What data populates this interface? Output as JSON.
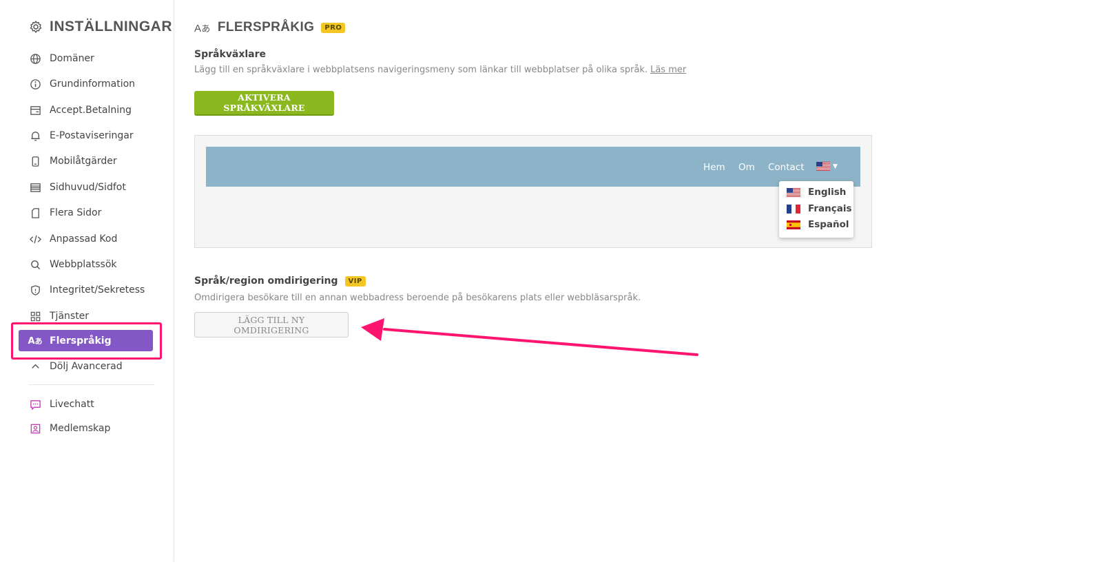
{
  "sidebar": {
    "title": "INSTÄLLNINGAR",
    "items": [
      {
        "label": "Domäner",
        "icon": "globe-icon"
      },
      {
        "label": "Grundinformation",
        "icon": "info-icon"
      },
      {
        "label": "Accept.Betalning",
        "icon": "payment-card-icon"
      },
      {
        "label": "E-Postaviseringar",
        "icon": "bell-icon"
      },
      {
        "label": "Mobilåtgärder",
        "icon": "mobile-icon"
      },
      {
        "label": "Sidhuvud/Sidfot",
        "icon": "header-footer-icon"
      },
      {
        "label": "Flera Sidor",
        "icon": "pages-icon"
      },
      {
        "label": "Anpassad Kod",
        "icon": "code-icon"
      },
      {
        "label": "Webbplatssök",
        "icon": "search-icon"
      },
      {
        "label": "Integritet/Sekretess",
        "icon": "shield-icon"
      },
      {
        "label": "Tjänster",
        "icon": "grid-icon"
      },
      {
        "label": "Flerspråkig",
        "icon": "translate-icon",
        "active": true
      },
      {
        "label": "Dölj Avancerad",
        "icon": "chevron-up-icon"
      }
    ],
    "extra": [
      {
        "label": "Livechatt",
        "icon": "chat-icon"
      },
      {
        "label": "Medlemskap",
        "icon": "member-icon"
      }
    ],
    "accent_color": "#8357c5",
    "highlight_color": "#ff1470"
  },
  "page": {
    "title": "FLERSPRÅKIG",
    "badge": "PRO"
  },
  "switcher": {
    "title": "Språkväxlare",
    "desc": "Lägg till en språkväxlare i webbplatsens navigeringsmeny som länkar till webbplatser på olika språk.",
    "link": "Läs mer",
    "button": "AKTIVERA SPRÅKVÄXLARE",
    "button_color": "#8ab81e"
  },
  "preview": {
    "links": [
      "Hem",
      "Om",
      "Contact"
    ],
    "languages": [
      "English",
      "Français",
      "Español"
    ],
    "bar_color": "#8db3c8"
  },
  "redirect": {
    "title": "Språk/region omdirigering",
    "badge": "VIP",
    "desc": "Omdirigera besökare till en annan webbadress beroende på besökarens plats eller webbläsarspråk.",
    "button": "LÄGG TILL NY OMDIRIGERING"
  }
}
